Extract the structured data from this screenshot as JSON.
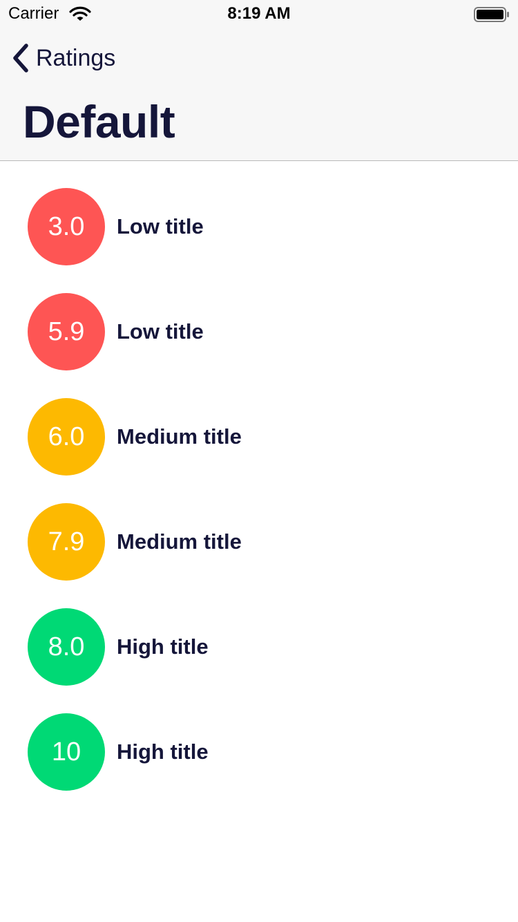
{
  "status_bar": {
    "carrier": "Carrier",
    "time": "8:19 AM",
    "wifi_icon": "wifi-icon",
    "battery_icon": "battery-icon"
  },
  "nav": {
    "back_icon": "chevron-left-icon",
    "back_label": "Ratings",
    "title": "Default"
  },
  "colors": {
    "low": "#fe5554",
    "medium": "#fdb901",
    "high": "#00d975",
    "text": "#15163a"
  },
  "items": [
    {
      "rating": "3.0",
      "title": "Low title",
      "level": "low"
    },
    {
      "rating": "5.9",
      "title": "Low title",
      "level": "low"
    },
    {
      "rating": "6.0",
      "title": "Medium title",
      "level": "medium"
    },
    {
      "rating": "7.9",
      "title": "Medium title",
      "level": "medium"
    },
    {
      "rating": "8.0",
      "title": "High title",
      "level": "high"
    },
    {
      "rating": "10",
      "title": "High title",
      "level": "high"
    }
  ]
}
